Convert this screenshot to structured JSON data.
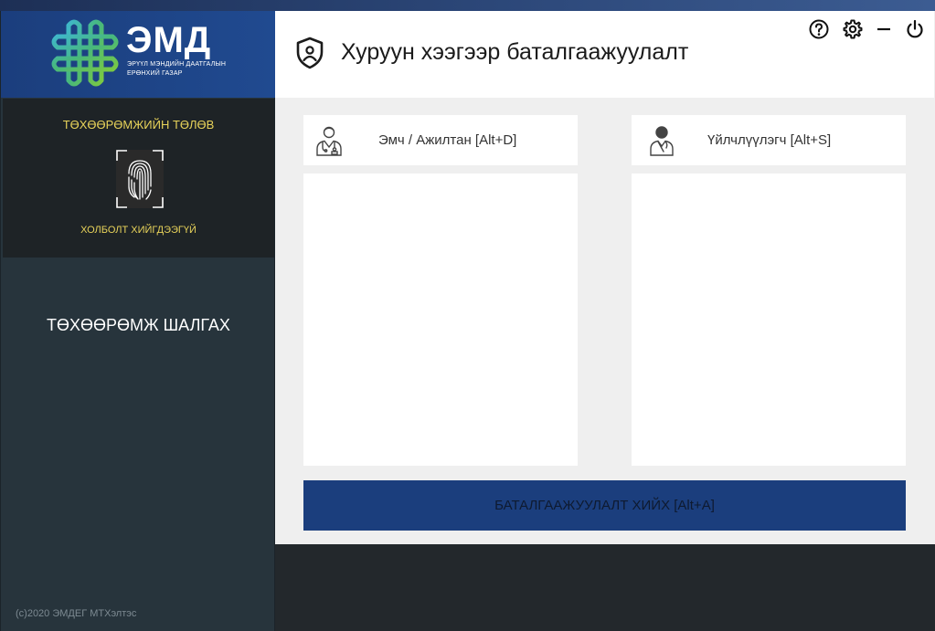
{
  "brand": {
    "title": "ЭМД",
    "subtitle_line1": "ЭРҮҮЛ МЭНДИЙН ДААТГАЛЫН",
    "subtitle_line2": "ЕРӨНХИЙ ГАЗАР"
  },
  "device": {
    "status_title": "ТӨХӨӨРӨМЖИЙН ТӨЛӨВ",
    "connection_status": "ХОЛБОЛТ ХИЙГДЭЭГҮЙ",
    "check_label": "ТӨХӨӨРӨМЖ ШАЛГАХ"
  },
  "footer": {
    "copyright": "(c)2020  ЭМДЕГ МТХэлтэс"
  },
  "header": {
    "title": "Хуруун хээгээр баталгаажуулалт",
    "icons": [
      "help-icon",
      "settings-icon",
      "minimize-icon",
      "power-icon"
    ]
  },
  "cards": {
    "doctor_label": "Эмч / Ажилтан [Alt+D]",
    "patient_label": "Үйлчлүүлэгч [Alt+S]"
  },
  "actions": {
    "verify_label": "БАТАЛГААЖУУЛАЛТ ХИЙХ  [Alt+A]"
  },
  "colors": {
    "brand_blue": "#1b3e7d",
    "status_yellow": "#e8d35a",
    "sidebar": "#27343c"
  }
}
